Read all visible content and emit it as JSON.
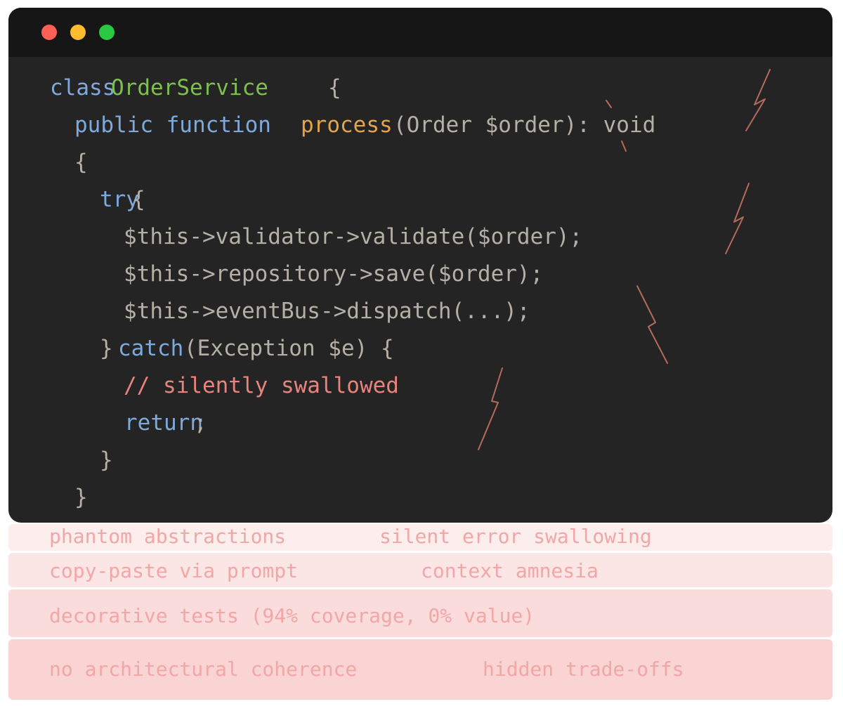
{
  "colors": {
    "window_bg": "#242424",
    "titlebar_bg": "#161616",
    "keyword": "#7ea9dc",
    "class_name": "#7fbf4f",
    "function_name": "#e4a54a",
    "plain": "#b5b0a6",
    "comment": "#e8837d",
    "crack": "#b56a5e",
    "traffic_close": "#fe5f57",
    "traffic_minimize": "#febc2e",
    "traffic_maximize": "#28c840",
    "issue_text": "#f2a6a6"
  },
  "code": {
    "line1": {
      "kw": "class",
      "name": "OrderService",
      "brace": "{"
    },
    "line2": {
      "kw": "public function",
      "fn": "process",
      "rest": "(Order $order): void"
    },
    "line3": {
      "brace": "{"
    },
    "line4": {
      "kw": "try",
      "brace": "{"
    },
    "line5": "$this->validator->validate($order);",
    "line6": "$this->repository->save($order);",
    "line7": "$this->eventBus->dispatch(...);",
    "line8": {
      "close": "}",
      "kw": "catch",
      "rest": "(Exception $e) {"
    },
    "line9": "// silently swallowed",
    "line10": {
      "kw": "return",
      "semi": ";"
    },
    "line11": "}",
    "line12": "}"
  },
  "issues": [
    {
      "left": "phantom abstractions",
      "right": "silent error swallowing"
    },
    {
      "left": "copy-paste via prompt",
      "right": "context amnesia"
    },
    {
      "left": "decorative tests (94% coverage, 0% value)"
    },
    {
      "left": "no architectural coherence",
      "right": "hidden trade-offs"
    }
  ]
}
